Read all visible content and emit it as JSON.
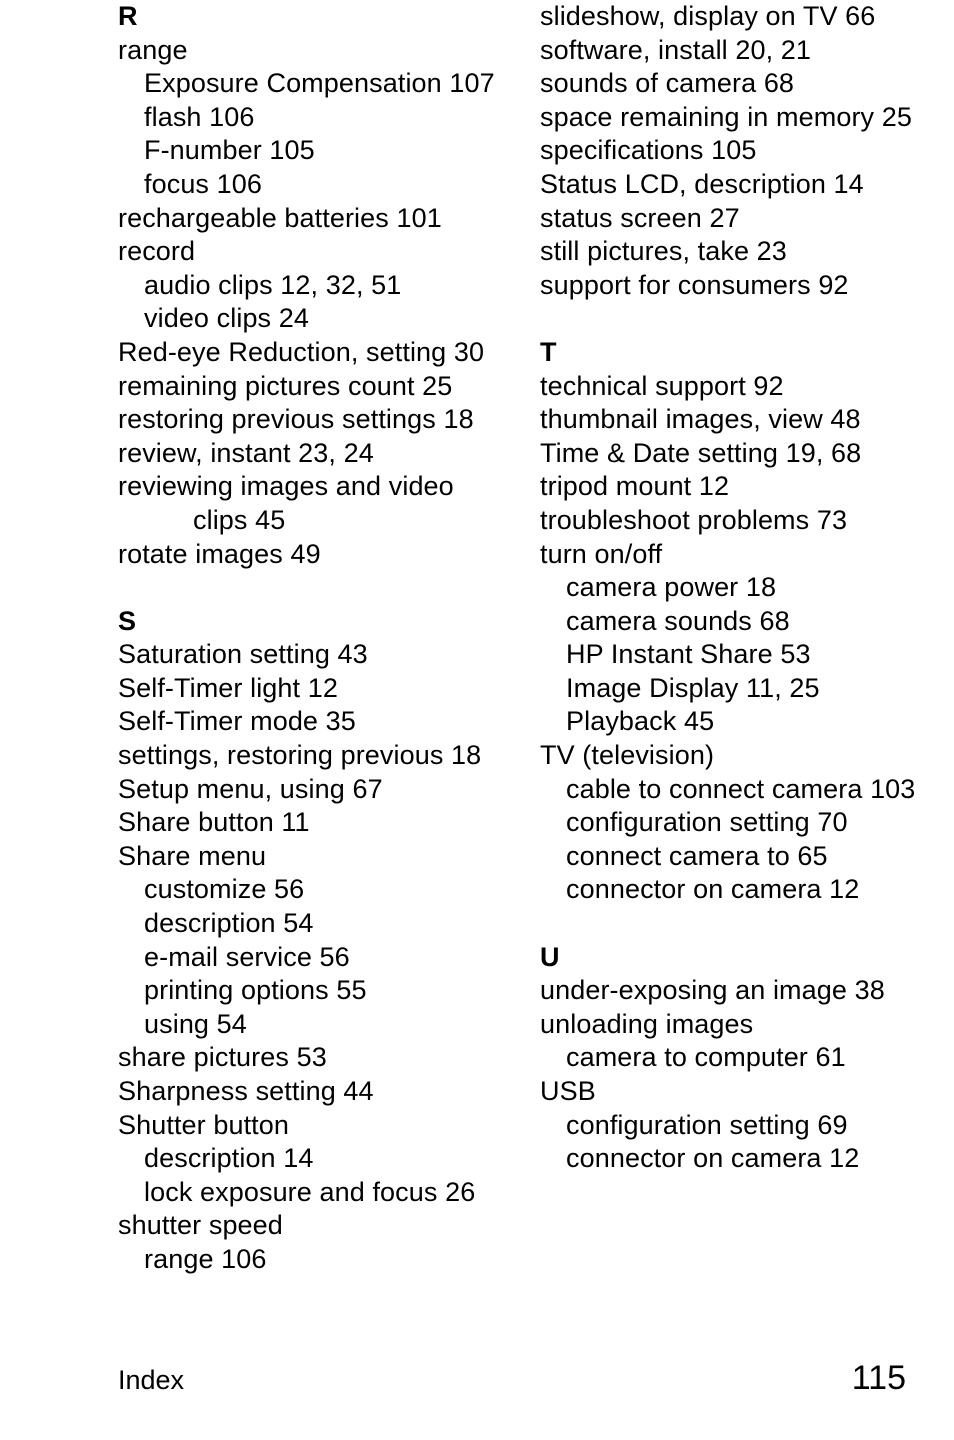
{
  "document": {
    "kind": "printed-index-page",
    "footer": {
      "label": "Index",
      "page_number": "115"
    }
  },
  "columns": {
    "left": {
      "blocks": [
        {
          "heading": "R",
          "entries": [
            {
              "text": "range",
              "level": 0
            },
            {
              "text": "Exposure Compensation 107",
              "level": 1
            },
            {
              "text": "flash 106",
              "level": 1
            },
            {
              "text": "F-number 105",
              "level": 1
            },
            {
              "text": "focus 106",
              "level": 1
            },
            {
              "text": "rechargeable batteries 101",
              "level": 0
            },
            {
              "text": "record",
              "level": 0
            },
            {
              "text": "audio clips 12, 32, 51",
              "level": 1
            },
            {
              "text": "video clips 24",
              "level": 1
            },
            {
              "text": "Red-eye Reduction, setting 30",
              "level": 0
            },
            {
              "text": "remaining pictures count 25",
              "level": 0
            },
            {
              "text": "restoring previous settings 18",
              "level": 0
            },
            {
              "text": "review, instant 23, 24",
              "level": 0
            },
            {
              "text": "reviewing images and video",
              "level": 0
            },
            {
              "text": "clips 45",
              "level": 2
            },
            {
              "text": "rotate images 49",
              "level": 0
            }
          ]
        },
        {
          "heading": "S",
          "entries": [
            {
              "text": "Saturation setting 43",
              "level": 0
            },
            {
              "text": "Self-Timer light 12",
              "level": 0
            },
            {
              "text": "Self-Timer mode 35",
              "level": 0
            },
            {
              "text": "settings, restoring previous 18",
              "level": 0
            },
            {
              "text": "Setup menu, using 67",
              "level": 0
            },
            {
              "text": "Share button 11",
              "level": 0
            },
            {
              "text": "Share menu",
              "level": 0
            },
            {
              "text": "customize 56",
              "level": 1
            },
            {
              "text": "description 54",
              "level": 1
            },
            {
              "text": "e-mail service 56",
              "level": 1
            },
            {
              "text": "printing options 55",
              "level": 1
            },
            {
              "text": "using 54",
              "level": 1
            },
            {
              "text": "share pictures 53",
              "level": 0
            },
            {
              "text": "Sharpness setting 44",
              "level": 0
            },
            {
              "text": "Shutter button",
              "level": 0
            },
            {
              "text": "description 14",
              "level": 1
            },
            {
              "text": "lock exposure and focus 26",
              "level": 1
            },
            {
              "text": "shutter speed",
              "level": 0
            },
            {
              "text": "range 106",
              "level": 1
            }
          ]
        }
      ]
    },
    "right": {
      "blocks": [
        {
          "heading": "",
          "entries": [
            {
              "text": "slideshow, display on TV 66",
              "level": 0
            },
            {
              "text": "software, install 20, 21",
              "level": 0
            },
            {
              "text": "sounds of camera 68",
              "level": 0
            },
            {
              "text": "space remaining in memory 25",
              "level": 0
            },
            {
              "text": "specifications 105",
              "level": 0
            },
            {
              "text": "Status LCD, description 14",
              "level": 0
            },
            {
              "text": "status screen 27",
              "level": 0
            },
            {
              "text": "still pictures, take 23",
              "level": 0
            },
            {
              "text": "support for consumers 92",
              "level": 0
            }
          ]
        },
        {
          "heading": "T",
          "entries": [
            {
              "text": "technical support 92",
              "level": 0
            },
            {
              "text": "thumbnail images, view 48",
              "level": 0
            },
            {
              "text": "Time & Date setting 19, 68",
              "level": 0
            },
            {
              "text": "tripod mount 12",
              "level": 0
            },
            {
              "text": "troubleshoot problems 73",
              "level": 0
            },
            {
              "text": "turn on/off",
              "level": 0
            },
            {
              "text": "camera power 18",
              "level": 1
            },
            {
              "text": "camera sounds 68",
              "level": 1
            },
            {
              "text": "HP Instant Share 53",
              "level": 1
            },
            {
              "text": "Image Display 11, 25",
              "level": 1
            },
            {
              "text": "Playback 45",
              "level": 1
            },
            {
              "text": "TV (television)",
              "level": 0
            },
            {
              "text": "cable to connect camera 103",
              "level": 1
            },
            {
              "text": "configuration setting 70",
              "level": 1
            },
            {
              "text": "connect camera to 65",
              "level": 1
            },
            {
              "text": "connector on camera 12",
              "level": 1
            }
          ]
        },
        {
          "heading": "U",
          "entries": [
            {
              "text": "under-exposing an image 38",
              "level": 0
            },
            {
              "text": "unloading images",
              "level": 0
            },
            {
              "text": "camera to computer 61",
              "level": 1
            },
            {
              "text": "USB",
              "level": 0
            },
            {
              "text": "configuration setting 69",
              "level": 1
            },
            {
              "text": "connector on camera 12",
              "level": 1
            }
          ]
        }
      ]
    }
  }
}
